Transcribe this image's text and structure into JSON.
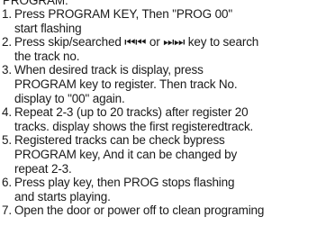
{
  "heading": "PROGRAM:",
  "steps": [
    {
      "num": "1.",
      "lines": [
        "Press  PROGRAM KEY, Then \"PROG 00\"",
        "start flashing"
      ]
    },
    {
      "num": "2.",
      "lines": [
        "Press skip/searched ⏮⏮ or ⏭⏭ key to search",
        "the track no."
      ]
    },
    {
      "num": "3.",
      "lines": [
        "When desired track is display, press",
        "PROGRAM key to register. Then track No.",
        "display to \"00\" again."
      ]
    },
    {
      "num": "4.",
      "lines": [
        "Repeat 2-3 (up to 20 tracks) after register 20",
        "tracks. display shows the first registeredtrack."
      ]
    },
    {
      "num": "5.",
      "lines": [
        "Registered tracks can be check bypress",
        "PROGRAM key, And it can be changed by",
        "repeat 2-3."
      ]
    },
    {
      "num": "6.",
      "lines": [
        "Press play key, then PROG stops flashing",
        "and starts playing."
      ]
    },
    {
      "num": "7.",
      "lines": [
        "Open the door or power off to clean programing"
      ]
    }
  ]
}
